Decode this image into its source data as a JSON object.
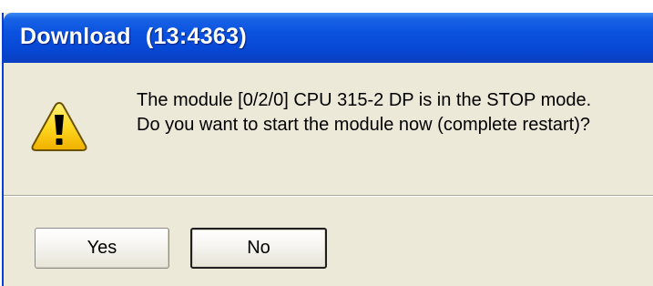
{
  "dialog": {
    "title_name": "Download",
    "title_id": "(13:4363)",
    "message_line1": "The module [0/2/0] CPU 315-2 DP is in the STOP mode.",
    "message_line2": "Do you want to start the module now (complete restart)?",
    "icon": "warning-icon"
  },
  "buttons": {
    "yes_label": "Yes",
    "no_label": "No"
  },
  "colors": {
    "titlebar": "#0a52de",
    "dialog_bg": "#ece9d8",
    "icon_yellow": "#ffd820"
  }
}
